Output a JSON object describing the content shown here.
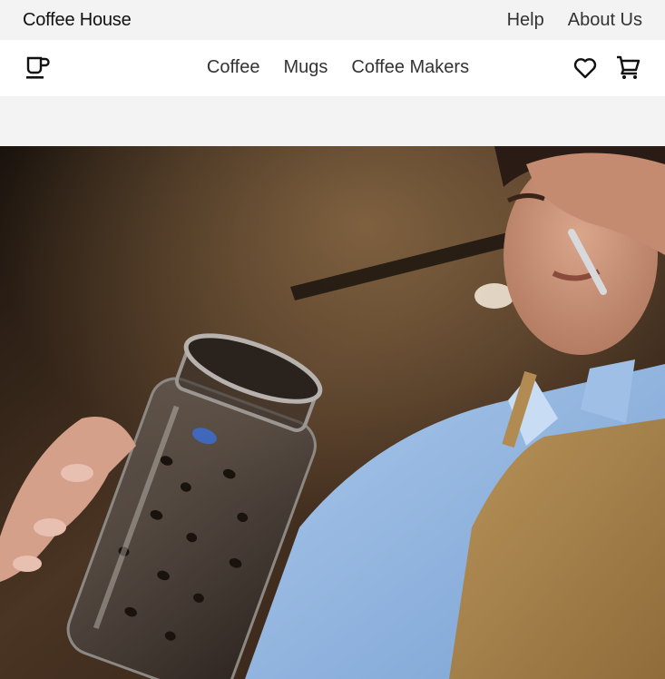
{
  "topbar": {
    "brand": "Coffee House",
    "links": [
      "Help",
      "About Us"
    ]
  },
  "nav": {
    "logo_icon": "coffee-cup-icon",
    "items": [
      "Coffee",
      "Mugs",
      "Coffee Makers"
    ],
    "wishlist_icon": "heart-icon",
    "cart_icon": "shopping-cart-icon"
  },
  "hero": {
    "media": "video"
  }
}
